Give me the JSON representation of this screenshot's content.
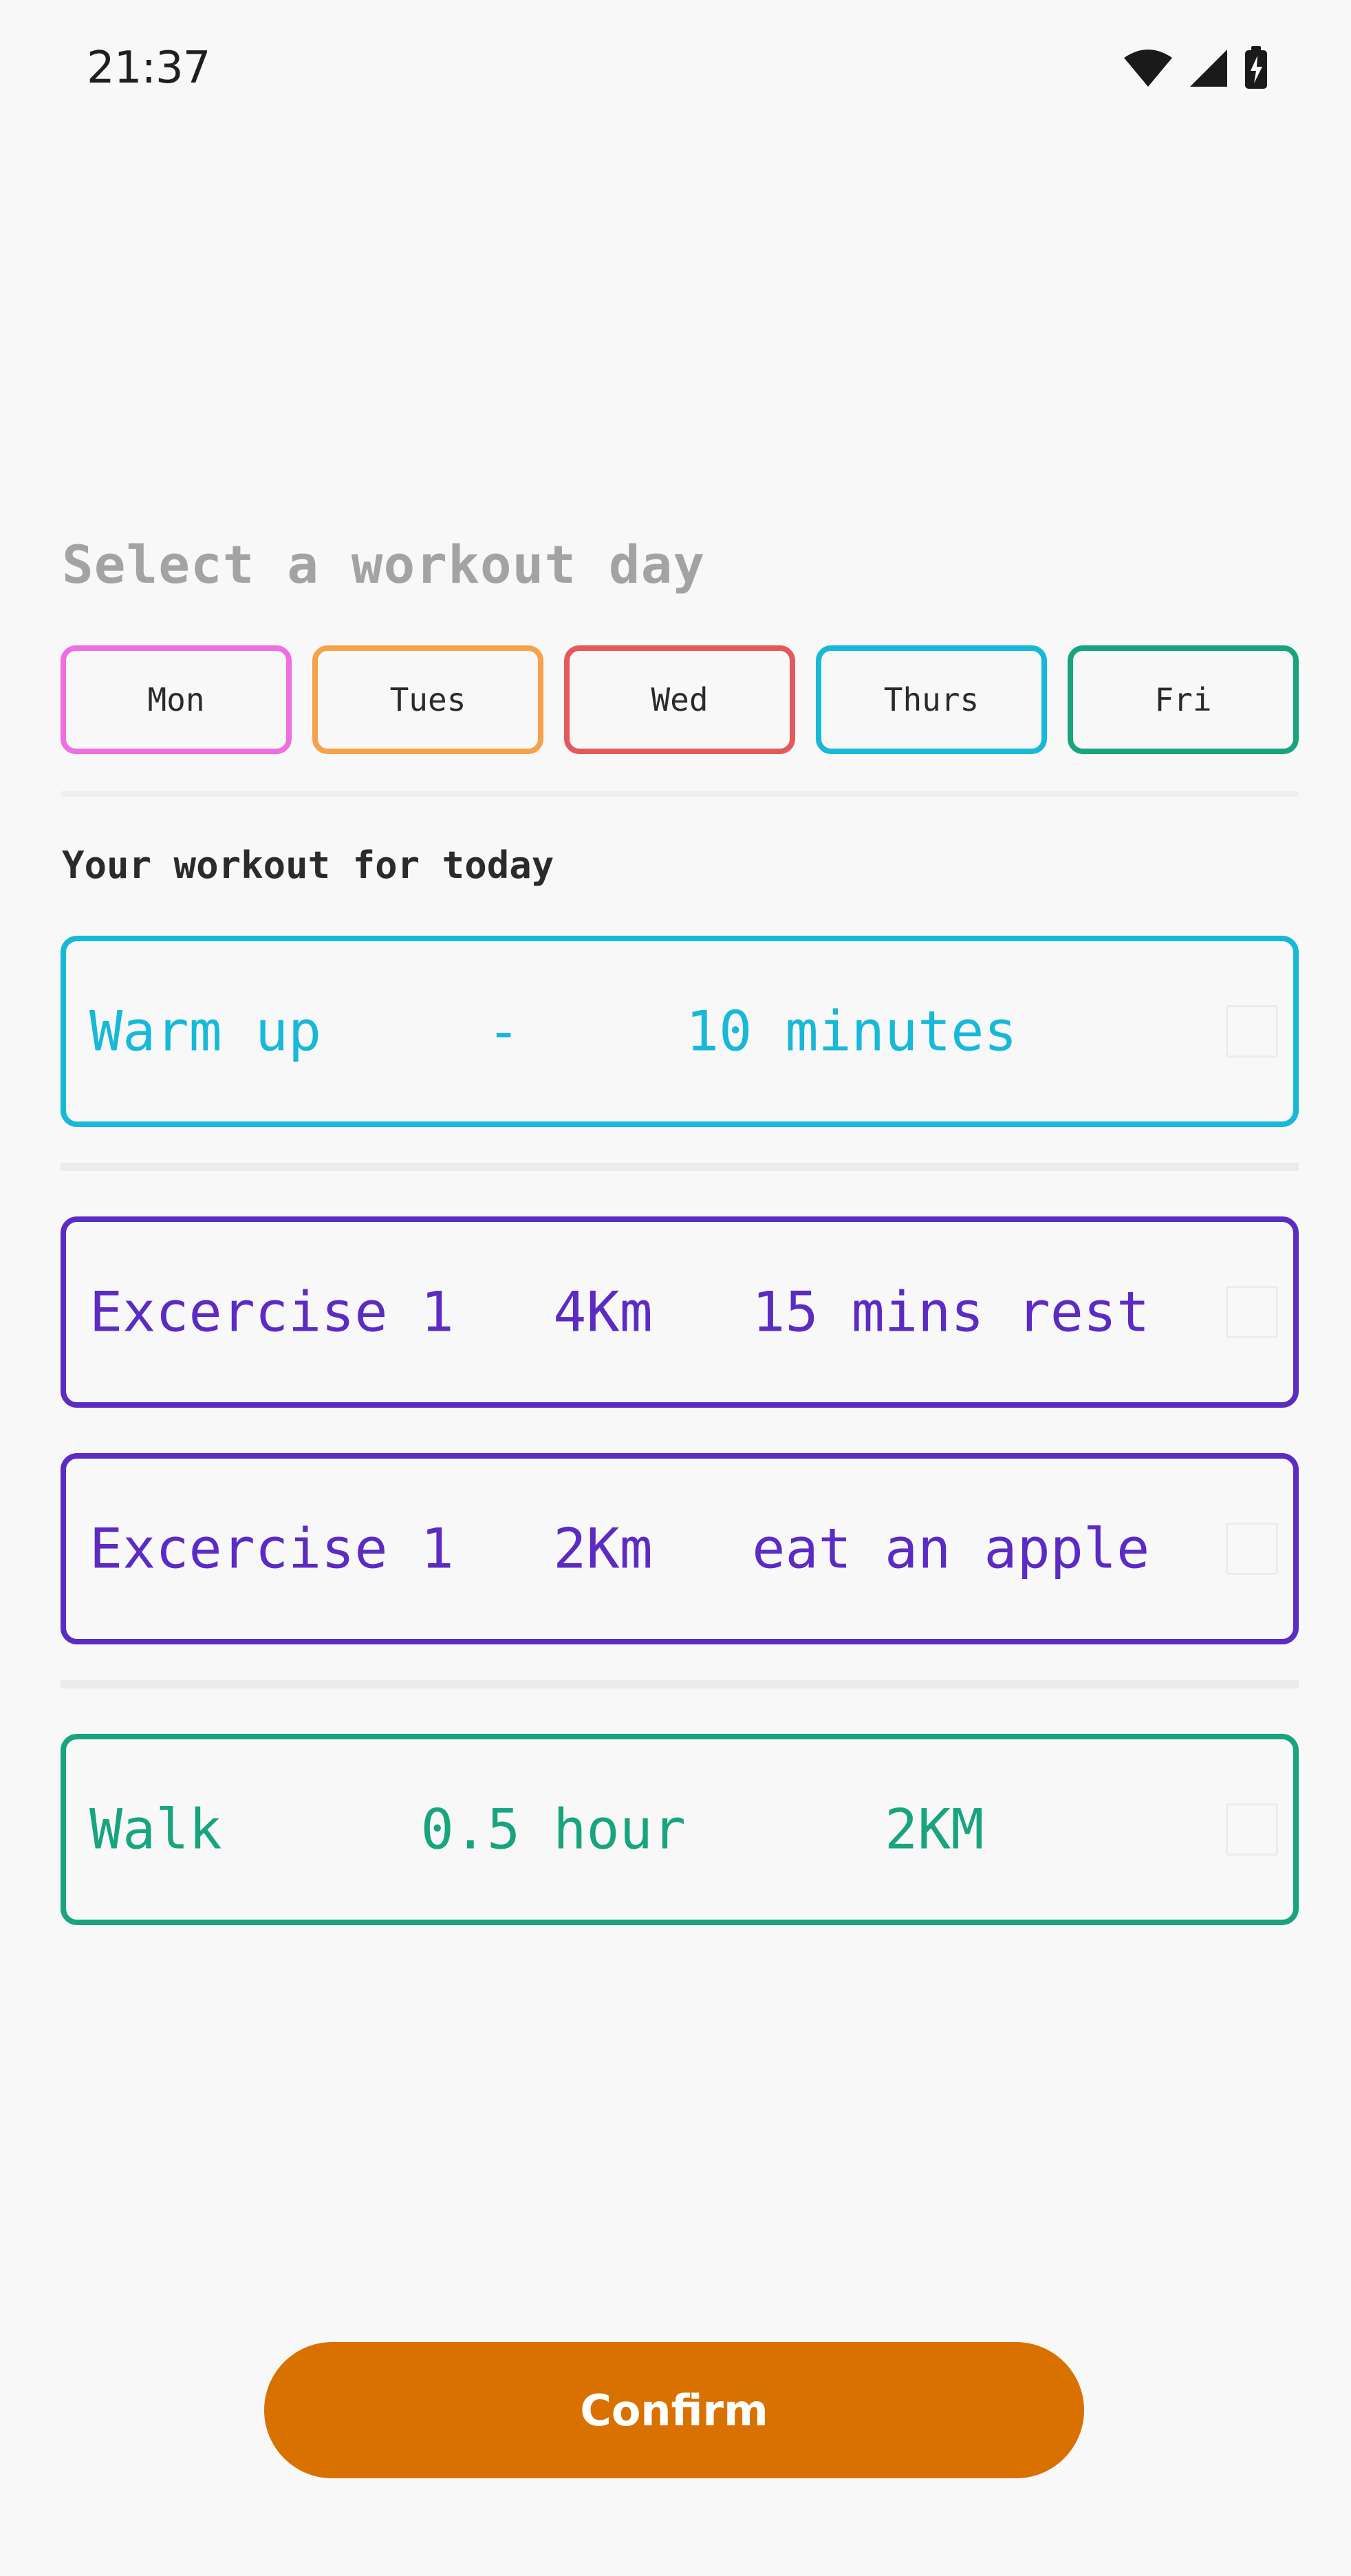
{
  "status_bar": {
    "time": "21:37",
    "icons": [
      "wifi-icon",
      "cellular-signal-icon",
      "battery-charging-icon"
    ]
  },
  "day_selector": {
    "title": "Select a workout day",
    "days": [
      {
        "label": "Mon",
        "color": "#ee6fe0"
      },
      {
        "label": "Tues",
        "color": "#f5a24a"
      },
      {
        "label": "Wed",
        "color": "#e45a5a"
      },
      {
        "label": "Thurs",
        "color": "#17b8d8"
      },
      {
        "label": "Fri",
        "color": "#18a47e"
      }
    ]
  },
  "workout": {
    "heading": "Your workout for today",
    "items": [
      {
        "text": "Warm up     -     10 minutes",
        "color": "#17b8d8",
        "checked": false
      },
      {
        "text": "Excercise 1   4Km   15 mins rest",
        "color": "#5b2bc4",
        "checked": false
      },
      {
        "text": "Excercise 1   2Km   eat an apple",
        "color": "#5b2bc4",
        "checked": false
      },
      {
        "text": "Walk      0.5 hour      2KM",
        "color": "#18a47e",
        "checked": false
      }
    ]
  },
  "confirm": {
    "label": "Confirm",
    "color": "#d97100"
  }
}
